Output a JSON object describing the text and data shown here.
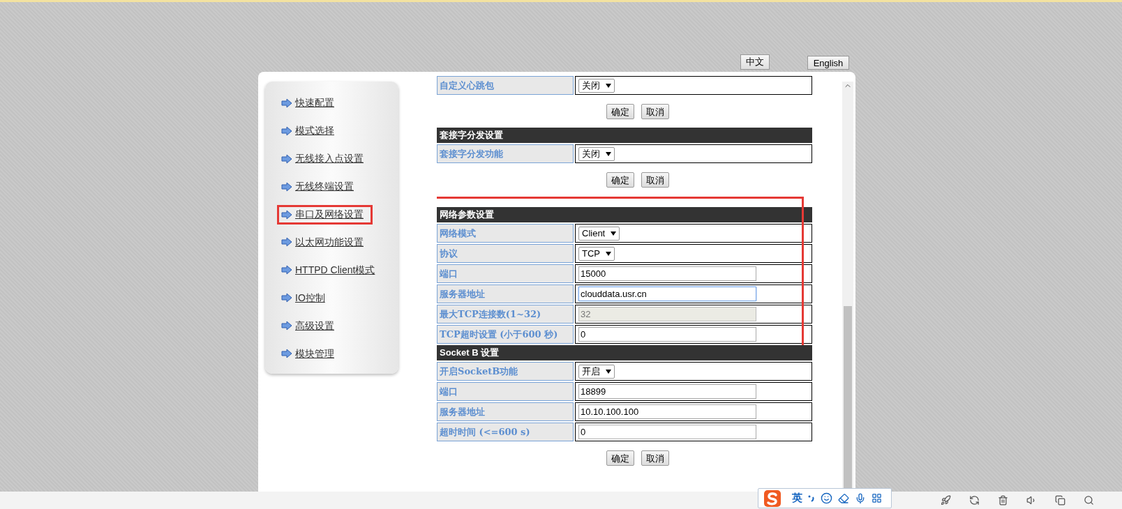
{
  "languages": [
    {
      "label": "中文"
    },
    {
      "label": "English"
    }
  ],
  "sidebar": {
    "items": [
      {
        "label": "快速配置",
        "selected": false
      },
      {
        "label": "模式选择",
        "selected": false
      },
      {
        "label": "无线接入点设置",
        "selected": false
      },
      {
        "label": "无线终端设置",
        "selected": false
      },
      {
        "label": "串口及网络设置",
        "selected": true
      },
      {
        "label": "以太网功能设置",
        "selected": false
      },
      {
        "label": "HTTPD Client模式",
        "selected": false
      },
      {
        "label": "IO控制",
        "selected": false
      },
      {
        "label": "高级设置",
        "selected": false
      },
      {
        "label": "模块管理",
        "selected": false
      }
    ]
  },
  "sections": [
    {
      "highlighted": false,
      "rows": [
        {
          "label": "自定义心跳包",
          "kind": "select",
          "value": "关闭"
        }
      ],
      "buttons": [
        "确定",
        "取消"
      ]
    },
    {
      "title": "套接字分发设置",
      "highlighted": false,
      "rows": [
        {
          "label": "套接字分发功能",
          "kind": "select",
          "value": "关闭"
        }
      ],
      "buttons": [
        "确定",
        "取消"
      ]
    },
    {
      "title": "网络参数设置",
      "highlighted": true,
      "rows": [
        {
          "label": "网络模式",
          "kind": "select",
          "value": "Client"
        },
        {
          "label": "协议",
          "kind": "select",
          "value": "TCP"
        },
        {
          "label": "端口",
          "kind": "text",
          "value": "15000",
          "focused": false
        },
        {
          "label": "服务器地址",
          "kind": "text",
          "value": "clouddata.usr.cn",
          "focused": true
        },
        {
          "label": "最大TCP连接数(1~32)",
          "kind": "disabled",
          "value": "32"
        },
        {
          "label": "TCP超时设置 (小于600 秒)",
          "kind": "text",
          "value": "0",
          "focused": false
        }
      ]
    },
    {
      "title": "Socket B 设置",
      "highlighted": false,
      "rows": [
        {
          "label": "开启SocketB功能",
          "kind": "select",
          "value": "开启"
        },
        {
          "label": "端口",
          "kind": "text",
          "value": "18899",
          "focused": false
        },
        {
          "label": "服务器地址",
          "kind": "text",
          "value": "10.10.100.100",
          "focused": false
        },
        {
          "label": "超时时间 (<=600 s)",
          "kind": "text",
          "value": "0",
          "focused": false
        }
      ],
      "buttons": [
        "确定",
        "取消"
      ]
    }
  ],
  "ime_toolbar": {
    "mode": "英"
  }
}
